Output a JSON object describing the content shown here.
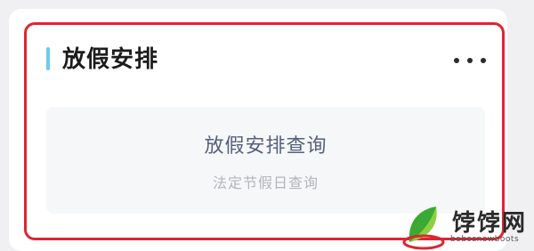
{
  "card": {
    "title": "放假安排",
    "more_icon": "more-horizontal-icon"
  },
  "entry": {
    "title": "放假安排查询",
    "subtitle": "法定节假日查询"
  },
  "watermark": {
    "brand": "饽饽网",
    "domain": "bobosnowboots"
  },
  "colors": {
    "accent": "#6ecbea",
    "highlight_border": "#e0242f",
    "entry_title": "#55617a",
    "entry_subtitle": "#b1b4bb"
  }
}
